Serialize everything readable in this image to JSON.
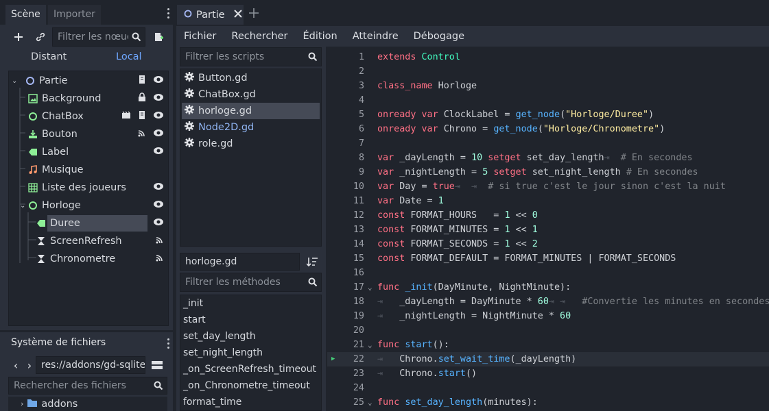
{
  "scene_dock": {
    "tabs": [
      "Scène",
      "Importer"
    ],
    "filter_placeholder": "Filtrer les nœuds",
    "remote_label": "Distant",
    "local_label": "Local",
    "tree": [
      {
        "label": "Partie",
        "icon": "control-node-icon"
      },
      {
        "label": "Background",
        "icon": "texture-rect-icon"
      },
      {
        "label": "ChatBox",
        "icon": "control-node-icon"
      },
      {
        "label": "Bouton",
        "icon": "button-node-icon"
      },
      {
        "label": "Label",
        "icon": "label-node-icon"
      },
      {
        "label": "Musique",
        "icon": "audio-node-icon"
      },
      {
        "label": "Liste des joueurs",
        "icon": "grid-container-icon"
      },
      {
        "label": "Horloge",
        "icon": "control-node-icon"
      },
      {
        "label": "Duree",
        "icon": "label-node-icon"
      },
      {
        "label": "ScreenRefresh",
        "icon": "timer-node-icon"
      },
      {
        "label": "Chronometre",
        "icon": "timer-node-icon"
      }
    ]
  },
  "filesystem": {
    "title": "Système de fichiers",
    "path": "res://addons/gd-sqlite",
    "search_placeholder": "Rechercher des fichiers",
    "items": [
      "addons"
    ]
  },
  "editor": {
    "tab_label": "Partie",
    "menus": [
      "Fichier",
      "Rechercher",
      "Édition",
      "Atteindre",
      "Débogage"
    ],
    "filter_scripts_placeholder": "Filtrer les scripts",
    "scripts": [
      "Button.gd",
      "ChatBox.gd",
      "horloge.gd",
      "Node2D.gd",
      "role.gd"
    ],
    "current_script": "horloge.gd",
    "filter_methods_placeholder": "Filtrer les méthodes",
    "methods": [
      "_init",
      "start",
      "set_day_length",
      "set_night_length",
      "_on_ScreenRefresh_timeout",
      "_on_Chronometre_timeout",
      "format_time"
    ]
  },
  "code_lines": [
    {
      "n": "1",
      "html": "<span class=\"kw\">extends</span> <span class=\"ty\">Control</span>"
    },
    {
      "n": "2",
      "html": ""
    },
    {
      "n": "3",
      "html": "<span class=\"kw\">class_name</span> Horloge"
    },
    {
      "n": "4",
      "html": ""
    },
    {
      "n": "5",
      "html": "<span class=\"kw\">onready var</span> ClockLabel = <span class=\"fn\">get_node</span>(<span class=\"st\">\"Horloge/Duree\"</span>)"
    },
    {
      "n": "6",
      "html": "<span class=\"kw\">onready var</span> Chrono = <span class=\"fn\">get_node</span>(<span class=\"st\">\"Horloge/Chronometre\"</span>)"
    },
    {
      "n": "7",
      "html": ""
    },
    {
      "n": "8",
      "html": "<span class=\"kw\">var</span> _dayLength = <span class=\"nu\">10</span> <span class=\"kw\">setget</span> set_day_length<span class=\"tb\">⇥</span>  <span class=\"cm\"># En secondes</span>"
    },
    {
      "n": "9",
      "html": "<span class=\"kw\">var</span> _nightLength = <span class=\"nu\">5</span> <span class=\"kw\">setget</span> set_night_length <span class=\"cm\"># En secondes</span>"
    },
    {
      "n": "10",
      "html": "<span class=\"kw\">var</span> Day = <span class=\"kw\">true</span><span class=\"tb\">⇥  ⇥</span>  <span class=\"cm\"># si true c'est le jour sinon c'est la nuit</span>"
    },
    {
      "n": "11",
      "html": "<span class=\"kw\">var</span> Date = <span class=\"nu\">1</span>"
    },
    {
      "n": "12",
      "html": "<span class=\"kw\">const</span> FORMAT_HOURS   = <span class=\"nu\">1</span> &lt;&lt; <span class=\"nu\">0</span>"
    },
    {
      "n": "13",
      "html": "<span class=\"kw\">const</span> FORMAT_MINUTES = <span class=\"nu\">1</span> &lt;&lt; <span class=\"nu\">1</span>"
    },
    {
      "n": "14",
      "html": "<span class=\"kw\">const</span> FORMAT_SECONDS = <span class=\"nu\">1</span> &lt;&lt; <span class=\"nu\">2</span>"
    },
    {
      "n": "15",
      "html": "<span class=\"kw\">const</span> FORMAT_DEFAULT = FORMAT_MINUTES | FORMAT_SECONDS"
    },
    {
      "n": "16",
      "html": ""
    },
    {
      "n": "17",
      "html": "<span class=\"kw\">func</span> <span class=\"fn\">_init</span>(DayMinute, NightMinute):",
      "fold": true
    },
    {
      "n": "18",
      "html": "<span class=\"tb\">⇥</span>   _dayLength = DayMinute * <span class=\"nu\">60</span><span class=\"tb\">⇥ ⇥</span>   <span class=\"cm\">#Convertie les minutes en secondes</span>"
    },
    {
      "n": "19",
      "html": "<span class=\"tb\">⇥</span>   _nightLength = NightMinute * <span class=\"nu\">60</span>"
    },
    {
      "n": "20",
      "html": ""
    },
    {
      "n": "21",
      "html": "<span class=\"kw\">func</span> <span class=\"fn\">start</span>():",
      "fold": true
    },
    {
      "n": "22",
      "html": "<span class=\"tb\">⇥</span>   Chrono.<span class=\"fn\">set_wait_time</span>(_dayLength)",
      "active": true
    },
    {
      "n": "23",
      "html": "<span class=\"tb\">⇥</span>   Chrono.<span class=\"fn\">start</span>()"
    },
    {
      "n": "24",
      "html": ""
    },
    {
      "n": "25",
      "html": "<span class=\"kw\">func</span> <span class=\"fn\">set_day_length</span>(minutes):",
      "fold": true
    }
  ]
}
